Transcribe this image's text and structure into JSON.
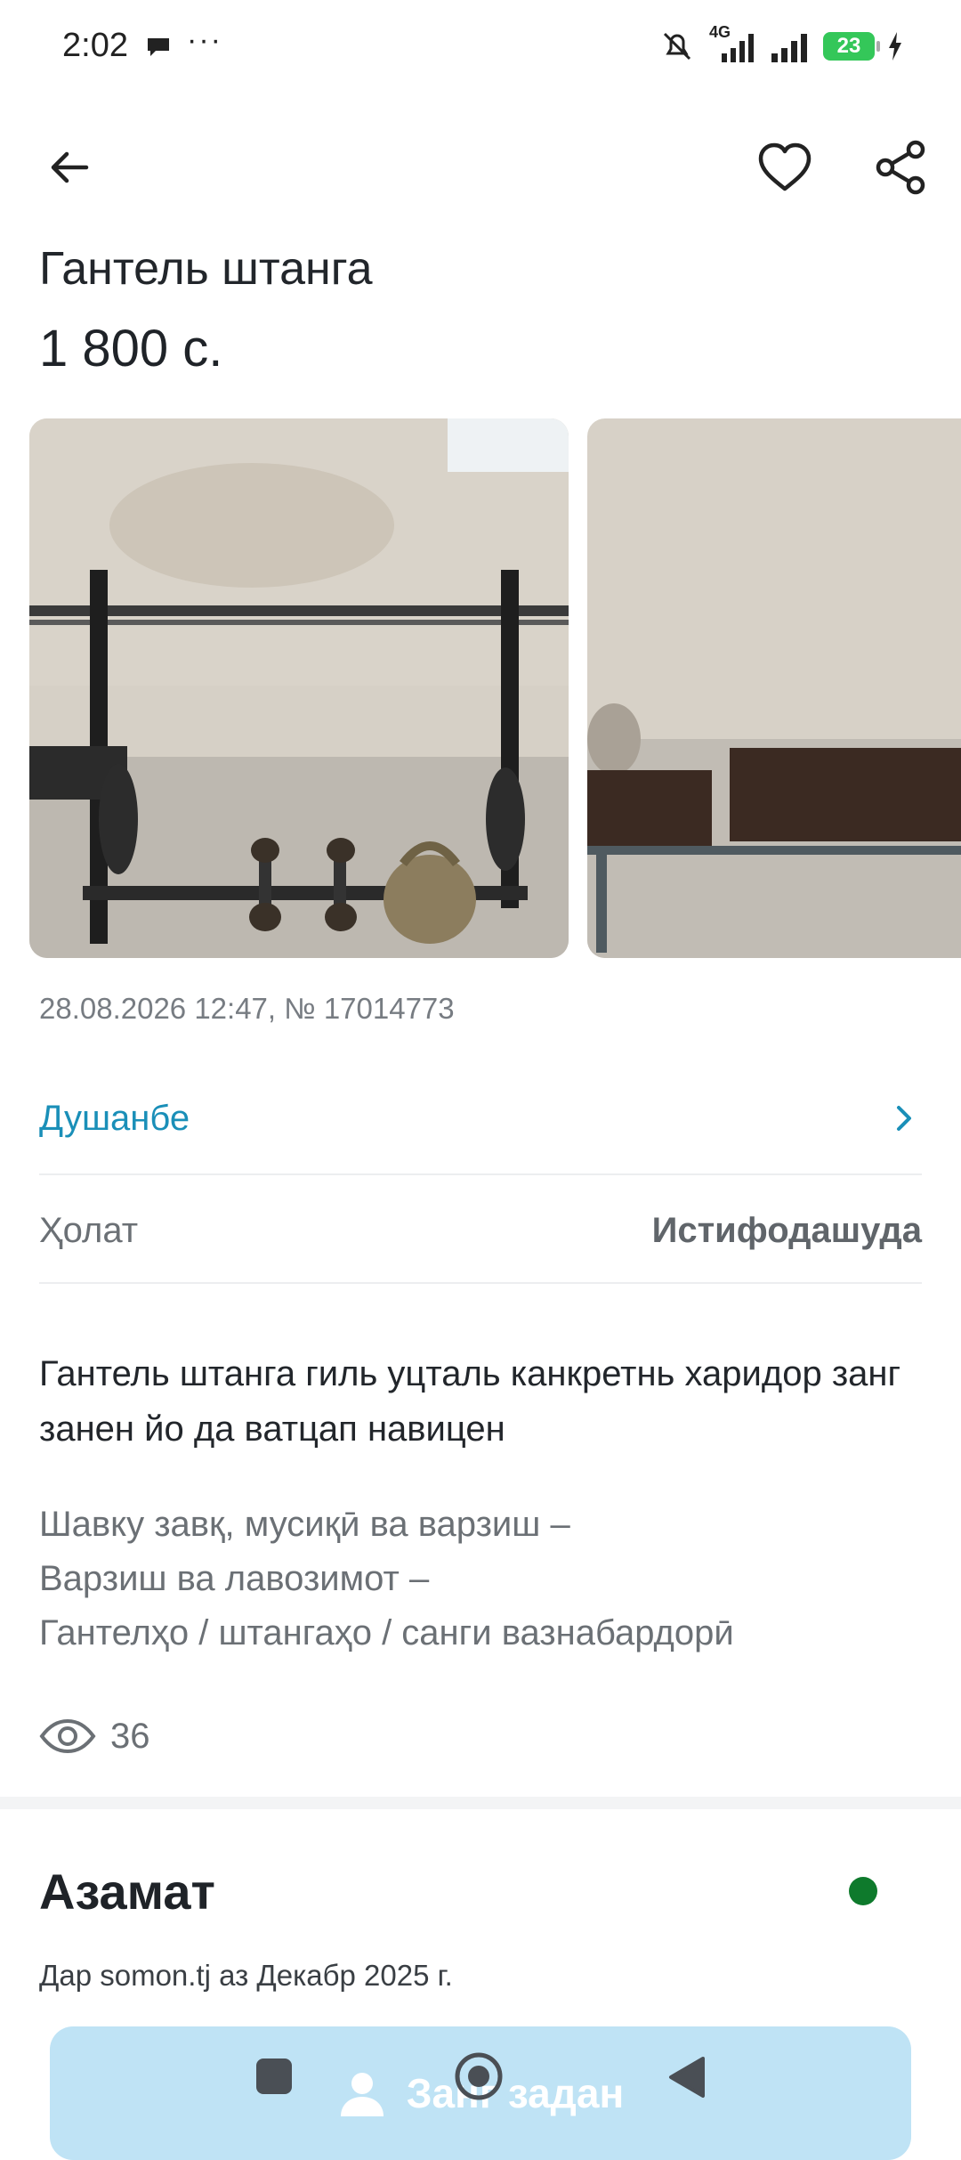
{
  "status_bar": {
    "time": "2:02",
    "more": "···",
    "network": "4G",
    "battery": "23"
  },
  "toolbar": {
    "back_icon": "arrow-left-icon",
    "favorite_icon": "heart-outline-icon",
    "share_icon": "share-icon"
  },
  "listing": {
    "title": "Гантель штанга",
    "price": "1 800 с.",
    "meta": "28.08.2026 12:47, № 17014773",
    "city": "Душанбе",
    "condition_label": "Ҳолат",
    "condition_value": "Истифодашуда",
    "description": "Гантель штанга гиль уцталь канкретнь харидор занг занен йо да ватцап навицен",
    "categories": [
      "Шавку завқ, мусиқӣ ва варзиш –",
      "Варзиш ва лавозимот –",
      "Гантелҳо / штангаҳо / санги вазнабардорӣ"
    ],
    "views": "36"
  },
  "seller": {
    "name": "Азамат",
    "since": "Дар somon.tj аз Декабр 2025 г.",
    "online_color": "#0e7a2c"
  },
  "call_button": {
    "label": "Занг задан",
    "icon": "user-icon"
  },
  "nav_bar": {
    "recent_icon": "square-icon",
    "home_icon": "circle-icon",
    "back_icon": "triangle-back-icon"
  },
  "colors": {
    "accent": "#1a8fb8",
    "call_button_bg": "#bfe3f5"
  }
}
